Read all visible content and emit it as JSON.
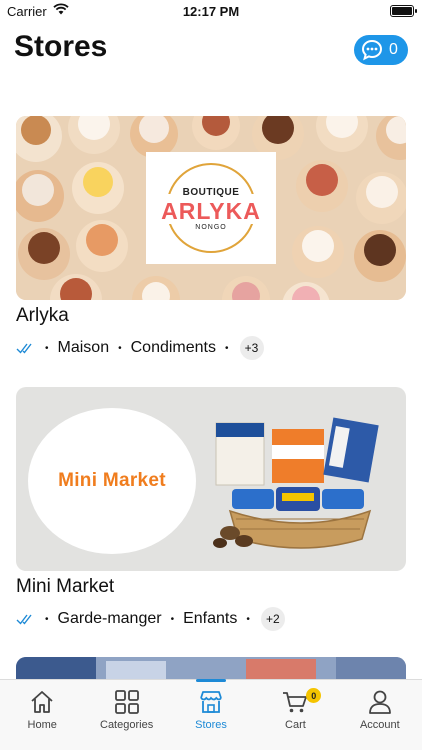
{
  "status_bar": {
    "carrier": "Carrier",
    "time": "12:17 PM"
  },
  "header": {
    "title": "Stores",
    "chat_count": "0"
  },
  "stores": [
    {
      "name": "Arlyka",
      "tags": [
        "Maison",
        "Condiments"
      ],
      "more": "+3",
      "logo": {
        "top": "BOUTIQUE",
        "main": "ARLYKA",
        "bottom": "NONGO"
      }
    },
    {
      "name": "Mini Market",
      "tags": [
        "Garde-manger",
        "Enfants"
      ],
      "more": "+2",
      "logo": {
        "main": "Mini Market"
      }
    }
  ],
  "tab_bar": {
    "items": [
      {
        "label": "Home",
        "icon": "home-icon"
      },
      {
        "label": "Categories",
        "icon": "grid-icon"
      },
      {
        "label": "Stores",
        "icon": "store-icon"
      },
      {
        "label": "Cart",
        "icon": "cart-icon"
      },
      {
        "label": "Account",
        "icon": "account-icon"
      }
    ],
    "active": "Stores",
    "cart_badge": "0"
  },
  "colors": {
    "accent": "#1e96e8",
    "tab_active": "#1e8ad6",
    "verified": "#1e8ad6",
    "mini_market_orange": "#f07d1e",
    "arlyka_coral": "#ec5a5a",
    "cart_badge": "#f5c400"
  }
}
